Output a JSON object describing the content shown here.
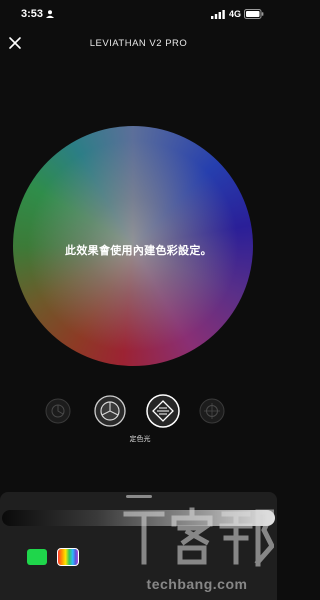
{
  "status_bar": {
    "time": "3:53",
    "network": "4G"
  },
  "header": {
    "title": "LEVIATHAN V2 PRO"
  },
  "color_wheel": {
    "message": "此效果會使用內建色彩設定。"
  },
  "modes": {
    "selected_caption": "定色光",
    "items": [
      {
        "icon": "mode-icon",
        "state": "dimmed"
      },
      {
        "icon": "spectrum-mode-icon",
        "state": "active"
      },
      {
        "icon": "static-mode-icon",
        "state": "selected"
      },
      {
        "icon": "mode-icon",
        "state": "dimmed"
      }
    ]
  },
  "bottom_sheet": {
    "swatches": [
      {
        "name": "green",
        "color": "#1fd64b"
      },
      {
        "name": "rainbow",
        "selected": true
      }
    ]
  },
  "watermark": {
    "logo_text": "T客邦",
    "site": "techbang.com"
  }
}
